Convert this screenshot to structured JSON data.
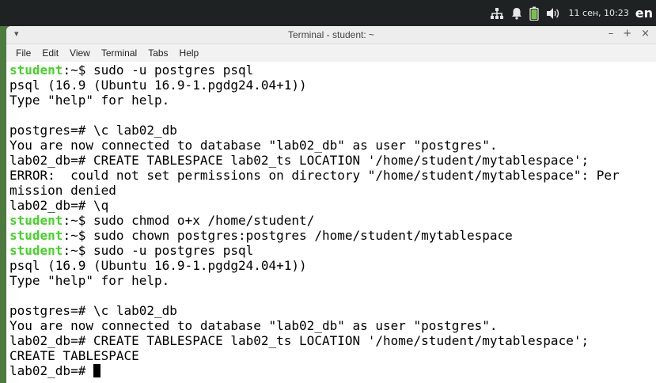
{
  "panel": {
    "clock": "11 сен, 10:23",
    "lang": "en",
    "icons": [
      "network-icon",
      "bell-icon",
      "battery-icon",
      "volume-icon"
    ]
  },
  "window": {
    "title": "Terminal - student: ~",
    "menu": [
      "File",
      "Edit",
      "View",
      "Terminal",
      "Tabs",
      "Help"
    ],
    "controls": [
      "–",
      "+",
      "×"
    ]
  },
  "terminal": {
    "lines": [
      {
        "user": "student",
        "text": ":~$ sudo -u postgres psql"
      },
      {
        "text": "psql (16.9 (Ubuntu 16.9-1.pgdg24.04+1))"
      },
      {
        "text": "Type \"help\" for help."
      },
      {
        "text": ""
      },
      {
        "text": "postgres=# \\c lab02_db"
      },
      {
        "text": "You are now connected to database \"lab02_db\" as user \"postgres\"."
      },
      {
        "text": "lab02_db=# CREATE TABLESPACE lab02_ts LOCATION '/home/student/mytablespace';"
      },
      {
        "text": "ERROR:  could not set permissions on directory \"/home/student/mytablespace\": Per"
      },
      {
        "text": "mission denied"
      },
      {
        "text": "lab02_db=# \\q"
      },
      {
        "user": "student",
        "text": ":~$ sudo chmod o+x /home/student/"
      },
      {
        "user": "student",
        "text": ":~$ sudo chown postgres:postgres /home/student/mytablespace"
      },
      {
        "user": "student",
        "text": ":~$ sudo -u postgres psql"
      },
      {
        "text": "psql (16.9 (Ubuntu 16.9-1.pgdg24.04+1))"
      },
      {
        "text": "Type \"help\" for help."
      },
      {
        "text": ""
      },
      {
        "text": "postgres=# \\c lab02_db"
      },
      {
        "text": "You are now connected to database \"lab02_db\" as user \"postgres\"."
      },
      {
        "text": "lab02_db=# CREATE TABLESPACE lab02_ts LOCATION '/home/student/mytablespace';"
      },
      {
        "text": "CREATE TABLESPACE"
      },
      {
        "text": "lab02_db=# ",
        "cursor": true
      }
    ]
  },
  "colors": {
    "prompt_user": "#46d32a",
    "panel_bg": "#1f2223"
  }
}
